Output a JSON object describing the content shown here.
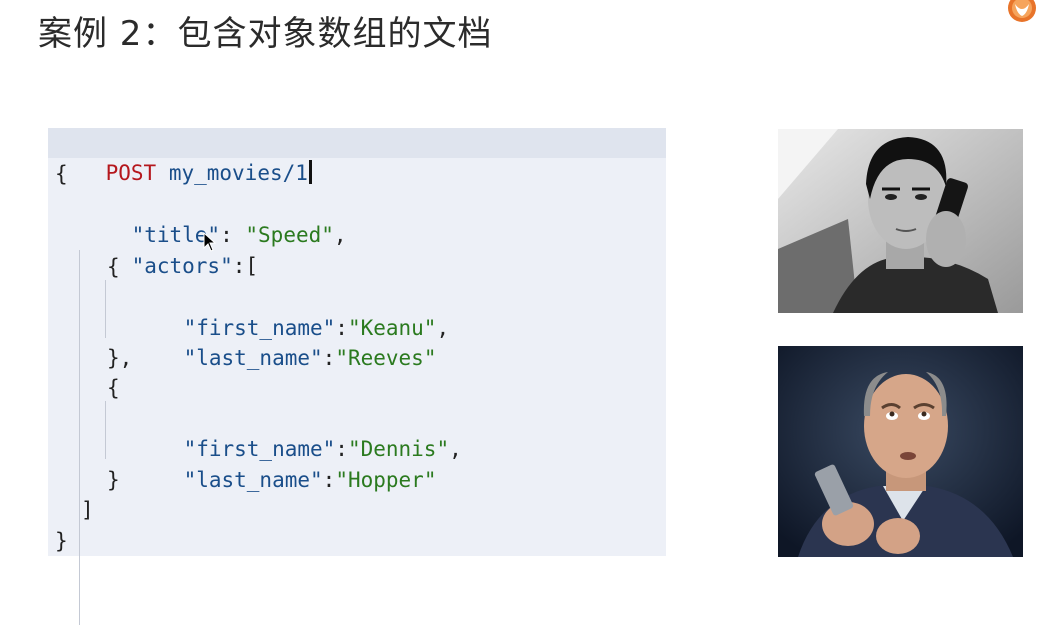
{
  "slide": {
    "title": "案例 2：包含对象数组的文档"
  },
  "request": {
    "method": "POST",
    "path": "my_movies/1"
  },
  "body": {
    "open_brace": "{",
    "title_key": "\"title\"",
    "title_value": "\"Speed\"",
    "actors_key": "\"actors\"",
    "actors": [
      {
        "first_name_key": "\"first_name\"",
        "first_name": "\"Keanu\"",
        "last_name_key": "\"last_name\"",
        "last_name": "\"Reeves\""
      },
      {
        "first_name_key": "\"first_name\"",
        "first_name": "\"Dennis\"",
        "last_name_key": "\"last_name\"",
        "last_name": "\"Hopper\""
      }
    ],
    "close_array": "]",
    "close_brace": "}"
  },
  "icons": {
    "logo": "elastic-logo-icon",
    "cursor": "mouse-pointer-icon"
  },
  "images": {
    "photo1": "keanu-reeves-photo",
    "photo2": "dennis-hopper-photo"
  },
  "colors": {
    "method": "#b5171d",
    "key": "#1a4e8a",
    "string": "#2b7a1f",
    "panel_bg": "#edf0f7"
  }
}
